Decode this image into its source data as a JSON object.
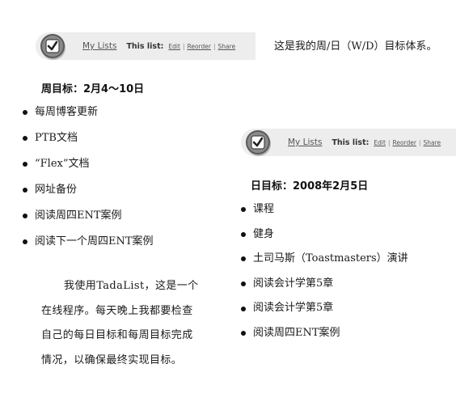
{
  "tada_bar": {
    "my_lists": "My Lists",
    "this_list": "This list:",
    "edit": "Edit",
    "reorder": "Reorder",
    "share": "Share",
    "separator": "|"
  },
  "caption": "这是我的周/日（W/D）目标体系。",
  "weekly": {
    "heading": "周目标：2月4～10日",
    "items": [
      "每周博客更新",
      "PTB文档",
      "“Flex”文档",
      "网址备份",
      "阅读周四ENT案例",
      "阅读下一个周四ENT案例"
    ]
  },
  "daily": {
    "heading": "日目标：2008年2月5日",
    "items": [
      "课程",
      "健身",
      "土司马斯（Toastmasters）演讲",
      "阅读会计学第5章",
      "阅读会计学第5章",
      "阅读周四ENT案例"
    ]
  },
  "paragraph": {
    "lines": [
      "我使用TadaList，这是一个",
      "在线程序。每天晚上我都要检查",
      "自己的每日目标和每周目标完成",
      "情况，以确保最终实现目标。"
    ]
  },
  "colors": {
    "bar_background": "#ededed",
    "logo_fill": "#8a8a8a",
    "text": "#1a1a1a"
  },
  "icons": [
    "checkmark-icon"
  ]
}
